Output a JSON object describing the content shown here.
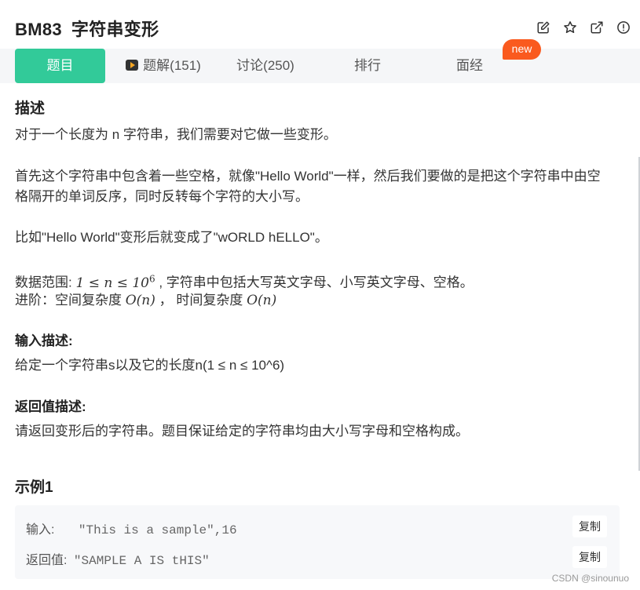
{
  "header": {
    "problem_id": "BM83",
    "problem_name": "字符串变形",
    "icons": [
      "edit-icon",
      "star-icon",
      "share-icon",
      "report-icon"
    ]
  },
  "tabs": [
    {
      "label": "题目",
      "active": true
    },
    {
      "label": "题解(151)",
      "icon": "video-icon"
    },
    {
      "label": "讨论(250)"
    },
    {
      "label": "排行"
    },
    {
      "label": "面经"
    }
  ],
  "new_badge": "new",
  "description": {
    "heading": "描述",
    "p1": "对于一个长度为 n 字符串，我们需要对它做一些变形。",
    "p2_line1": "首先这个字符串中包含着一些空格，就像\"Hello World\"一样，然后我们要做的是把这个字符串中由空",
    "p2_line2": "格隔开的单词反序，同时反转每个字符的大小写。",
    "p3": "比如\"Hello World\"变形后就变成了\"wORLD hELLO\"。",
    "range_label": "数据范围:",
    "range_math": "1 ≤ n ≤ 10",
    "range_exp": "6",
    "range_rest": ", 字符串中包括大写英文字母、小写英文字母、空格。",
    "adv_label": "进阶：空间复杂度",
    "adv_space": "O(n)",
    "adv_mid": "， 时间复杂度",
    "adv_time": "O(n)"
  },
  "input_desc": {
    "heading": "输入描述:",
    "text": "给定一个字符串s以及它的长度n(1 ≤ n ≤ 10^6)"
  },
  "output_desc": {
    "heading": "返回值描述:",
    "text": "请返回变形后的字符串。题目保证给定的字符串均由大小写字母和空格构成。"
  },
  "example": {
    "heading": "示例1",
    "input_label": "输入:",
    "input_value": "\"This is a sample\",16",
    "output_label": "返回值:",
    "output_value": "\"SAMPLE A IS tHIS\"",
    "copy_label": "复制"
  },
  "watermark": "CSDN @sinounuo",
  "colors": {
    "accent": "#32ca99",
    "badge": "#fa5a1e"
  }
}
